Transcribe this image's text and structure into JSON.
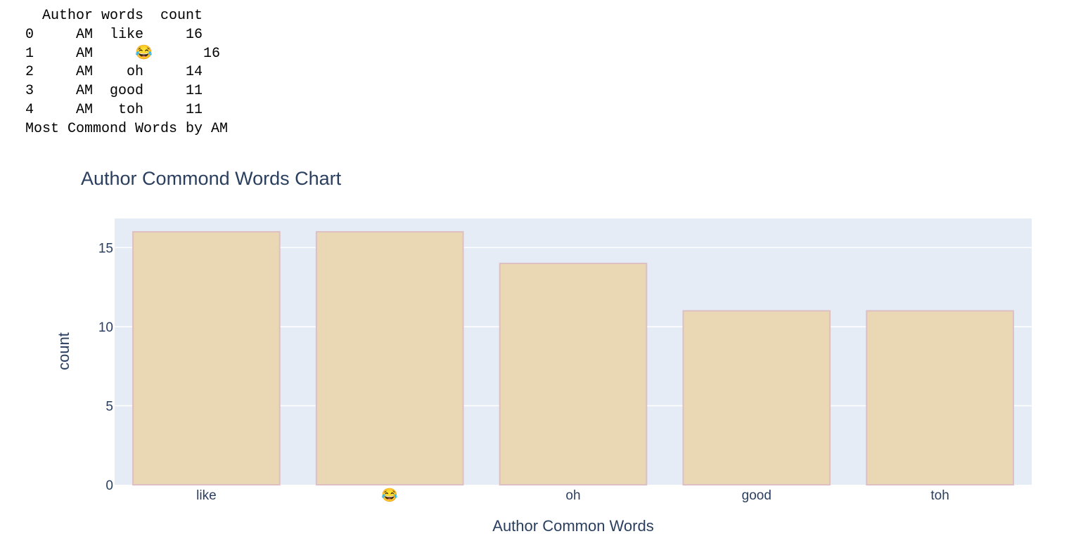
{
  "console_output": {
    "lines": [
      "  Author words  count",
      "0     AM  like     16",
      "1     AM     😂      16",
      "2     AM    oh     14",
      "3     AM  good     11",
      "4     AM   toh     11",
      "Most Commond Words by AM"
    ]
  },
  "chart_data": {
    "type": "bar",
    "title": "Author Commond Words Chart",
    "xlabel": "Author Common Words",
    "ylabel": "count",
    "categories": [
      "like",
      "😂",
      "oh",
      "good",
      "toh"
    ],
    "values": [
      16,
      16,
      14,
      11,
      11
    ],
    "ylim": [
      0,
      16.84
    ],
    "yticks": [
      0,
      5,
      10,
      15
    ],
    "grid": true,
    "legend": "none",
    "colors": {
      "bar_fill": "#ead7b3",
      "bar_stroke": "#ddbfc4",
      "plot_background": "#e5ecf6",
      "gridline": "#ffffff",
      "text": "#2a3f5f"
    }
  }
}
